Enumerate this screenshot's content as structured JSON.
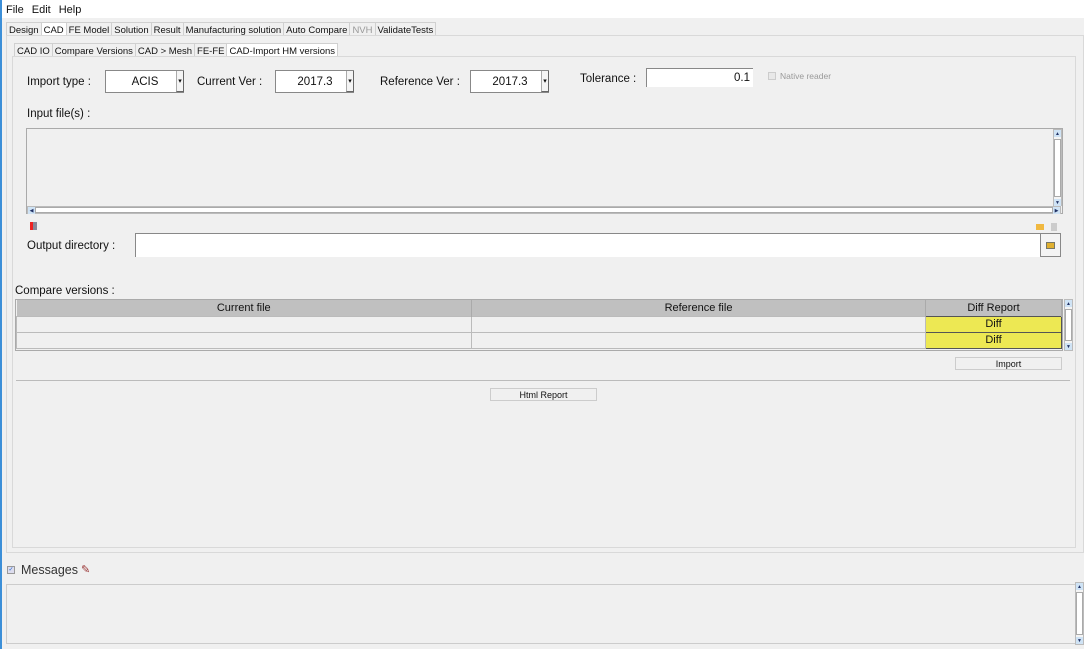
{
  "menu": [
    "File",
    "Edit",
    "Help"
  ],
  "main_tabs": [
    "Design",
    "CAD",
    "FE Model",
    "Solution",
    "Result",
    "Manufacturing solution",
    "Auto Compare",
    "NVH",
    "ValidateTests"
  ],
  "sub_tabs": [
    "CAD IO",
    "Compare Versions",
    "CAD > Mesh",
    "FE-FE",
    "CAD-Import HM versions"
  ],
  "form": {
    "import_type_label": "Import type :",
    "import_type_value": "ACIS",
    "current_ver_label": "Current Ver :",
    "current_ver_value": "2017.3",
    "reference_ver_label": "Reference Ver :",
    "reference_ver_value": "2017.3",
    "tolerance_label": "Tolerance :",
    "tolerance_value": "0.1",
    "native_reader_label": "Native reader",
    "input_files_label": "Input file(s) :",
    "output_dir_label": "Output directory :",
    "output_dir_value": ""
  },
  "compare": {
    "label": "Compare versions :",
    "headers": [
      "Current file",
      "Reference file",
      "Diff Report"
    ],
    "rows": [
      {
        "current": "",
        "reference": "",
        "diff": "Diff"
      },
      {
        "current": "",
        "reference": "",
        "diff": "Diff"
      }
    ],
    "import_label": "Import",
    "html_report_label": "Html Report"
  },
  "messages": {
    "label": "Messages"
  }
}
